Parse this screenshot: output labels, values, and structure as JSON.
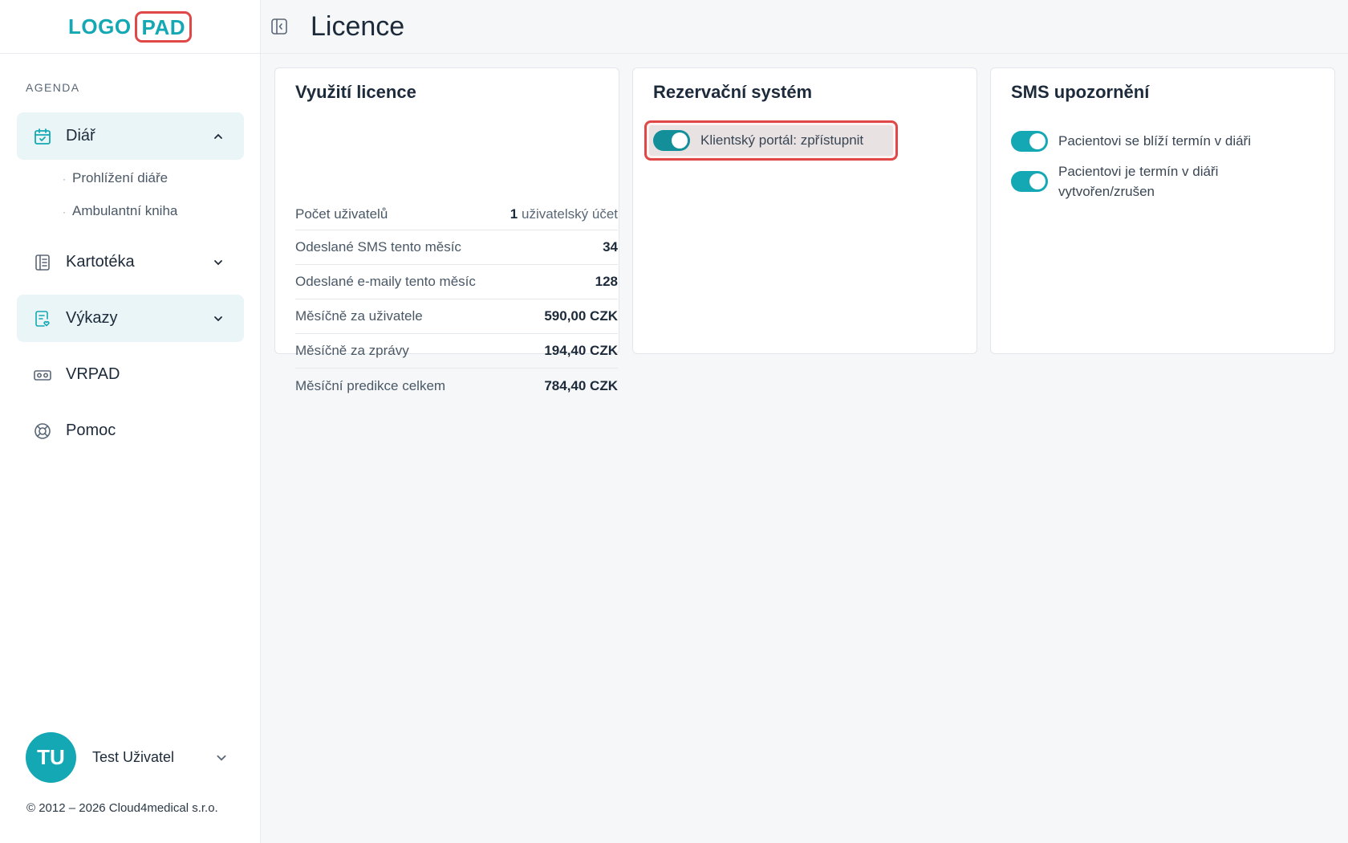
{
  "logo": {
    "left": "LOGO",
    "right": "PAD"
  },
  "header": {
    "title": "Licence"
  },
  "sidebar": {
    "section_label": "AGENDA",
    "items": [
      {
        "label": "Diář",
        "icon": "calendar-check-icon",
        "expanded": true,
        "children": [
          {
            "label": "Prohlížení diáře"
          },
          {
            "label": "Ambulantní kniha"
          }
        ]
      },
      {
        "label": "Kartotéka",
        "icon": "file-cabinet-icon"
      },
      {
        "label": "Výkazy",
        "icon": "report-icon"
      },
      {
        "label": "VRPAD",
        "icon": "vr-headset-icon"
      },
      {
        "label": "Pomoc",
        "icon": "lifebuoy-icon"
      }
    ],
    "user": {
      "initials": "TU",
      "name": "Test Uživatel"
    },
    "copyright": "© 2012 – 2026 Cloud4medical s.r.o."
  },
  "cards": {
    "license": {
      "title": "Využití licence",
      "rows": [
        {
          "label": "Počet uživatelů",
          "value": "1",
          "unit": "uživatelský účet"
        },
        {
          "label": "Odeslané SMS tento měsíc",
          "value": "34"
        },
        {
          "label": "Odeslané e-maily tento měsíc",
          "value": "128"
        },
        {
          "label": "Měsíčně za uživatele",
          "value": "590,00 CZK"
        },
        {
          "label": "Měsíčně za zprávy",
          "value": "194,40 CZK"
        },
        {
          "label": "Měsíční predikce celkem",
          "value": "784,40 CZK"
        }
      ]
    },
    "booking": {
      "title": "Rezervační systém",
      "portal_label": "Klientský portál: zpřístupnit",
      "portal_enabled": true
    },
    "sms": {
      "title": "SMS upozornění",
      "options": [
        {
          "label": "Pacientovi se blíží termín v diáři",
          "enabled": true
        },
        {
          "label": "Pacientovi je termín v diáři vytvořen/zrušen",
          "enabled": true
        }
      ]
    }
  },
  "colors": {
    "accent": "#14a8b4",
    "highlight": "#e04848",
    "active_bg": "#eaf5f7"
  }
}
